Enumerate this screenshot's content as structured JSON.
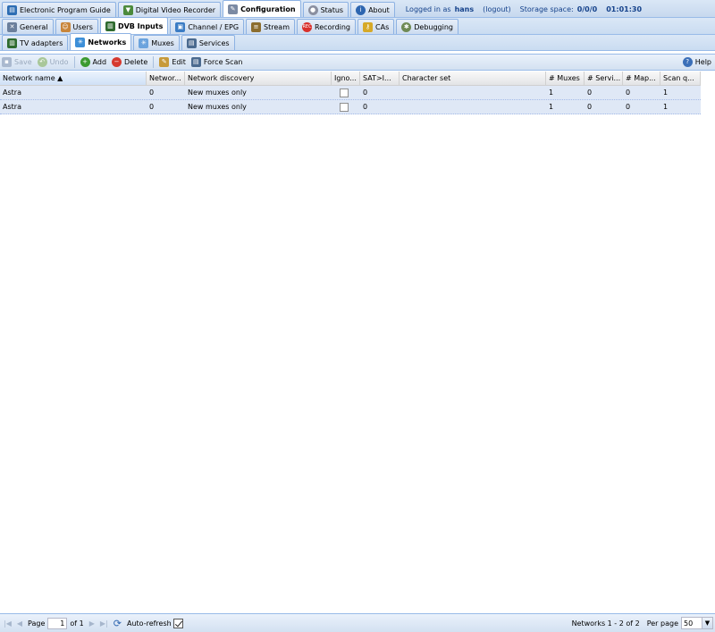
{
  "main_tabs": [
    {
      "label": "Electronic Program Guide",
      "icon": "epg-icon",
      "color": "#2d6db3",
      "active": false
    },
    {
      "label": "Digital Video Recorder",
      "icon": "dvr-icon",
      "color": "#4c8a3c",
      "active": false
    },
    {
      "label": "Configuration",
      "icon": "wrench-icon",
      "color": "#7b8aa3",
      "active": true
    },
    {
      "label": "Status",
      "icon": "status-icon",
      "color": "#8a8fa0",
      "active": false
    },
    {
      "label": "About",
      "icon": "info-icon",
      "color": "#2e66b0",
      "active": false
    }
  ],
  "login": {
    "prefix": "Logged in as",
    "user": "hans",
    "logout": "(logout)",
    "storage_label": "Storage space:",
    "storage_value": "0/0/0",
    "time": "01:01:30"
  },
  "config_tabs": [
    {
      "label": "General",
      "icon": "tools-icon",
      "color": "#6b7f9c",
      "active": false
    },
    {
      "label": "Users",
      "icon": "users-icon",
      "color": "#c8853a",
      "active": false
    },
    {
      "label": "DVB Inputs",
      "icon": "tv-card-icon",
      "color": "#2f6b2f",
      "active": true
    },
    {
      "label": "Channel / EPG",
      "icon": "channel-icon",
      "color": "#3b7cc4",
      "active": false
    },
    {
      "label": "Stream",
      "icon": "stream-icon",
      "color": "#8b6d2e",
      "active": false
    },
    {
      "label": "Recording",
      "icon": "rec-icon",
      "color": "#d9302b",
      "active": false
    },
    {
      "label": "CAs",
      "icon": "key-icon",
      "color": "#d6a928",
      "active": false
    },
    {
      "label": "Debugging",
      "icon": "bug-icon",
      "color": "#6f8a55",
      "active": false
    }
  ],
  "dvb_tabs": [
    {
      "label": "TV adapters",
      "icon": "adapter-icon",
      "color": "#2f6b2f",
      "active": false
    },
    {
      "label": "Networks",
      "icon": "network-icon",
      "color": "#3d8fd8",
      "active": true
    },
    {
      "label": "Muxes",
      "icon": "mux-icon",
      "color": "#6ba3dd",
      "active": false
    },
    {
      "label": "Services",
      "icon": "services-icon",
      "color": "#4b6a8f",
      "active": false
    }
  ],
  "toolbar": {
    "save": "Save",
    "undo": "Undo",
    "add": "Add",
    "delete": "Delete",
    "edit": "Edit",
    "force_scan": "Force Scan",
    "help": "Help"
  },
  "table": {
    "columns": [
      "Network name",
      "Networ...",
      "Network discovery",
      "Igno...",
      "SAT>I...",
      "Character set",
      "# Muxes",
      "# Servi...",
      "# Map...",
      "Scan q..."
    ],
    "rows": [
      [
        "Astra",
        "0",
        "New muxes only",
        "",
        "0",
        "",
        "1",
        "0",
        "0",
        "1"
      ],
      [
        "Astra",
        "0",
        "New muxes only",
        "",
        "0",
        "",
        "1",
        "0",
        "0",
        "1"
      ]
    ]
  },
  "paging": {
    "page_label": "Page",
    "page_value": "1",
    "of_label": "of 1",
    "auto_refresh": "Auto-refresh",
    "display_msg": "Networks 1 - 2 of 2",
    "per_page_label": "Per page",
    "per_page_value": "50"
  }
}
